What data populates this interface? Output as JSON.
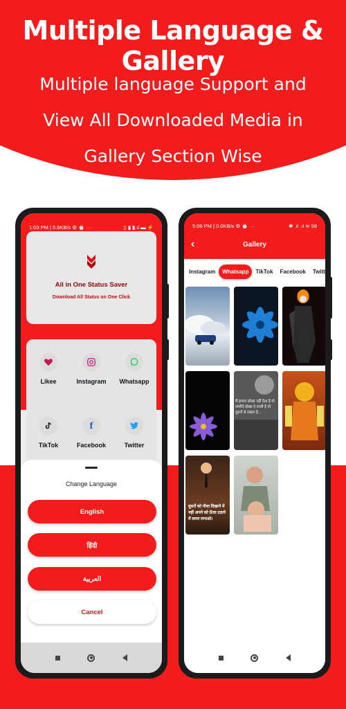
{
  "banner": {
    "headline": "Multiple Language & Gallery",
    "subline": "Multiple language Support and View  All Downloaded Media in Gallery Section Wise"
  },
  "colors": {
    "brand_red": "#f21c1c",
    "dark_red": "#8b0a0a"
  },
  "left_phone": {
    "status": {
      "time": "1:03 PM | 5.6KB/s ⚙ ⏰ ···",
      "icons": "▯ ▮ ▮.ıl  ▬ ⚡"
    },
    "hero": {
      "icon": "chevron-down-logo-icon",
      "title": "All in One Status Saver",
      "subtitle": "Download All Status on One Click"
    },
    "apps": [
      {
        "label": "Likee",
        "icon": "heart-icon"
      },
      {
        "label": "Instagram",
        "icon": "instagram-icon"
      },
      {
        "label": "Whatsapp",
        "icon": "whatsapp-icon"
      },
      {
        "label": "TikTok",
        "icon": "tiktok-icon"
      },
      {
        "label": "Facebook",
        "icon": "facebook-icon"
      },
      {
        "label": "Twitter",
        "icon": "twitter-icon"
      }
    ],
    "sheet": {
      "title": "Change Language",
      "options": [
        "English",
        "हिंदी",
        "العربية"
      ],
      "cancel": "Cancel"
    }
  },
  "right_phone": {
    "status": {
      "time": "5:06 PM | 0.0KB/s ⚙ ⏰ ···",
      "icons": "✱ .ıl .ıl ≋ 58"
    },
    "title": "Gallery",
    "tabs": [
      "Instagram",
      "Whatsapp",
      "TikTok",
      "Facebook",
      "Twitter"
    ],
    "active_tab": "Whatsapp",
    "thumbnails": [
      {
        "name": "car-smoke"
      },
      {
        "name": "blue-flower"
      },
      {
        "name": "ghost-rider"
      },
      {
        "name": "purple-flower"
      },
      {
        "name": "quote-boy",
        "text": "मैं हमारा धोखा नहीं देता है वो उम्मीदें धोखा दे जाती है वो दूसरों से रखता है..."
      },
      {
        "name": "hanuman"
      },
      {
        "name": "moon-quote",
        "text": "दूसरों को नीचा दिखाने में नहीं अपने को ऊँचा उठाने में समय लगाओ।"
      },
      {
        "name": "kids-photo"
      }
    ]
  }
}
